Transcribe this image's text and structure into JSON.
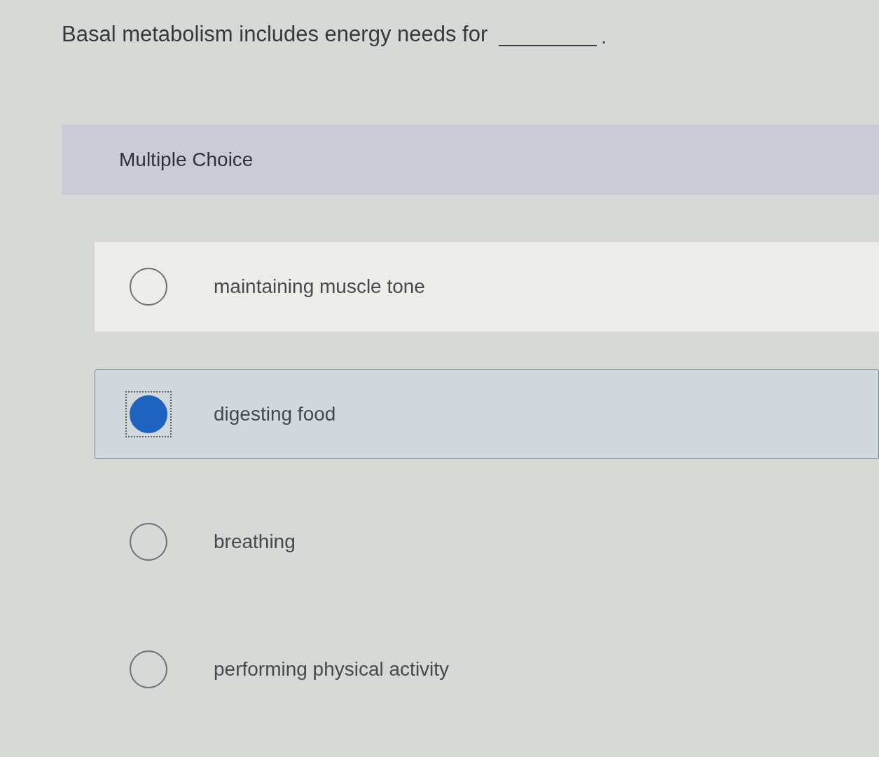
{
  "question": {
    "text": "Basal metabolism includes energy needs for",
    "end": "."
  },
  "section": {
    "title": "Multiple Choice"
  },
  "options": [
    {
      "text": "maintaining muscle tone",
      "selected": false,
      "focused": false,
      "hovered": true
    },
    {
      "text": "digesting food",
      "selected": true,
      "focused": true,
      "hovered": false
    },
    {
      "text": "breathing",
      "selected": false,
      "focused": false,
      "hovered": false
    },
    {
      "text": "performing physical activity",
      "selected": false,
      "focused": false,
      "hovered": false
    }
  ]
}
